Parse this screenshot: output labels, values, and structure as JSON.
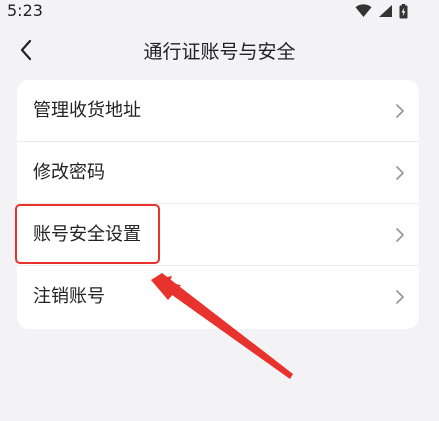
{
  "status_bar": {
    "time": "5:23",
    "icons": [
      "wifi-icon",
      "signal-icon",
      "battery-icon"
    ]
  },
  "nav": {
    "back_icon": "chevron-left-icon",
    "title": "通行证账号与安全"
  },
  "menu": {
    "items": [
      {
        "label": "管理收货地址",
        "icon": "chevron-right-icon"
      },
      {
        "label": "修改密码",
        "icon": "chevron-right-icon"
      },
      {
        "label": "账号安全设置",
        "icon": "chevron-right-icon"
      },
      {
        "label": "注销账号",
        "icon": "chevron-right-icon"
      }
    ]
  },
  "annotation": {
    "highlight_color": "#e8322e",
    "highlighted_item": "账号安全设置"
  },
  "colors": {
    "background": "#f3f3f5",
    "card": "#ffffff",
    "text": "#222222",
    "chevron": "#9a9a9a"
  }
}
